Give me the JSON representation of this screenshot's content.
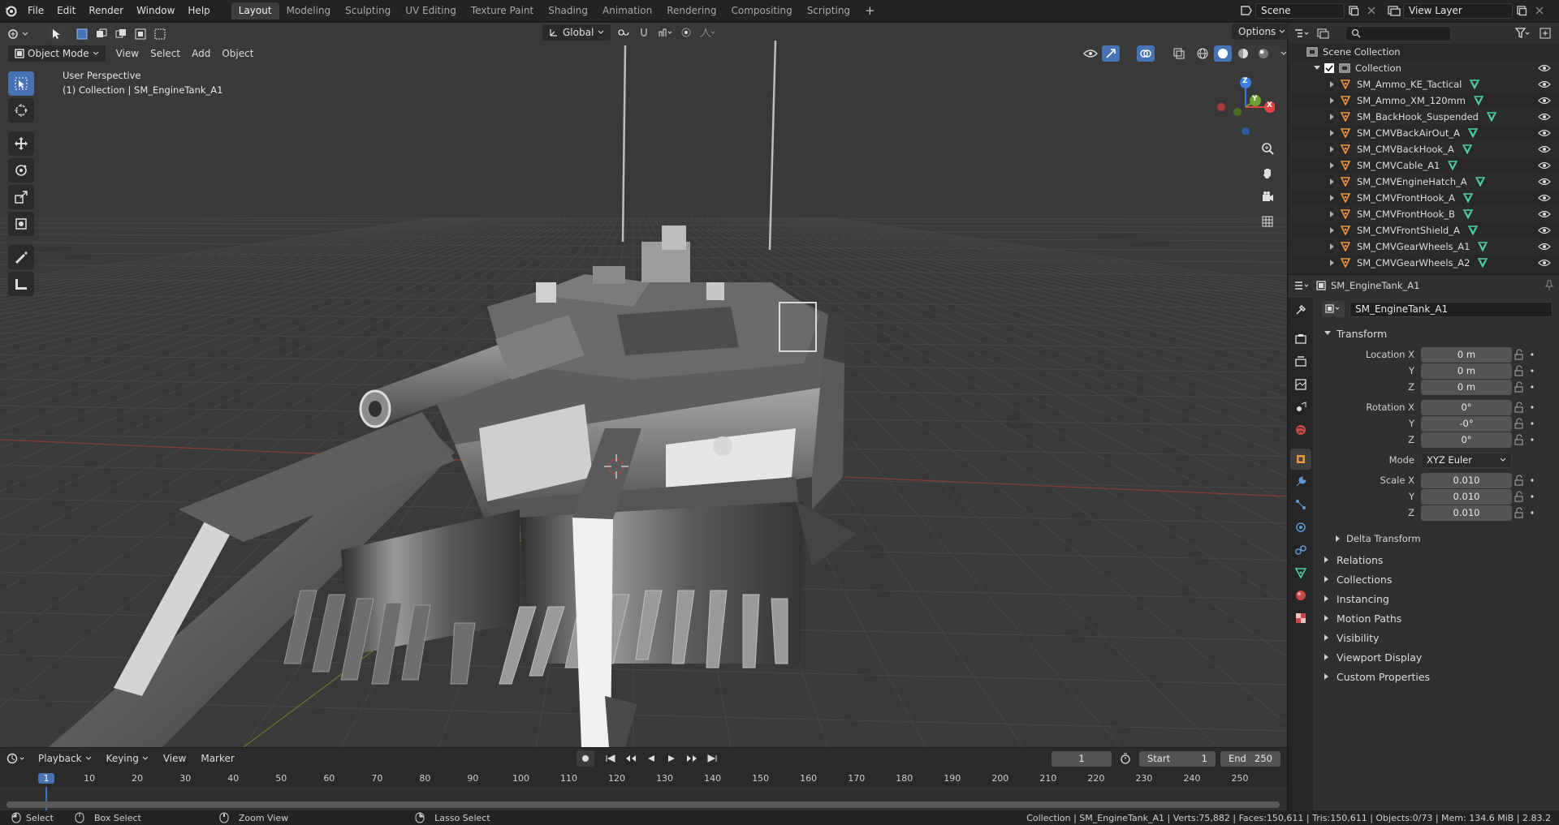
{
  "app": {
    "menu": [
      "File",
      "Edit",
      "Render",
      "Window",
      "Help"
    ]
  },
  "workspaces": {
    "tabs": [
      "Layout",
      "Modeling",
      "Sculpting",
      "UV Editing",
      "Texture Paint",
      "Shading",
      "Animation",
      "Rendering",
      "Compositing",
      "Scripting"
    ],
    "active": "Layout",
    "add": "+"
  },
  "scene": {
    "name": "Scene",
    "view_layer": "View Layer"
  },
  "viewport": {
    "mode": "Object Mode",
    "menus": [
      "View",
      "Select",
      "Add",
      "Object"
    ],
    "transform_orientation": "Global",
    "options_label": "Options",
    "overlay_line1": "User Perspective",
    "overlay_line2": "(1) Collection | SM_EngineTank_A1",
    "gizmo": {
      "z": "Z",
      "y": "Y",
      "x": "X"
    }
  },
  "outliner": {
    "root": "Scene Collection",
    "collection": "Collection",
    "items": [
      "SM_Ammo_KE_Tactical",
      "SM_Ammo_XM_120mm",
      "SM_BackHook_Suspended",
      "SM_CMVBackAirOut_A",
      "SM_CMVBackHook_A",
      "SM_CMVCable_A1",
      "SM_CMVEngineHatch_A",
      "SM_CMVFrontHook_A",
      "SM_CMVFrontHook_B",
      "SM_CMVFrontShield_A",
      "SM_CMVGearWheels_A1",
      "SM_CMVGearWheels_A2"
    ]
  },
  "properties": {
    "header_object": "SM_EngineTank_A1",
    "object_name": "SM_EngineTank_A1",
    "transform": {
      "title": "Transform",
      "location": {
        "label_x": "Location X",
        "x": "0 m",
        "y": "0 m",
        "z": "0 m"
      },
      "rotation": {
        "label_x": "Rotation X",
        "x": "0°",
        "y": "-0°",
        "z": "0°"
      },
      "mode_label": "Mode",
      "mode": "XYZ Euler",
      "scale": {
        "label_x": "Scale X",
        "x": "0.010",
        "y": "0.010",
        "z": "0.010"
      },
      "axis_y": "Y",
      "axis_z": "Z"
    },
    "delta_transform": "Delta Transform",
    "panels": [
      "Relations",
      "Collections",
      "Instancing",
      "Motion Paths",
      "Visibility",
      "Viewport Display",
      "Custom Properties"
    ]
  },
  "timeline": {
    "menus": [
      "Playback",
      "Keying",
      "View",
      "Marker"
    ],
    "current_frame": "1",
    "start_label": "Start",
    "start": "1",
    "end_label": "End",
    "end": "250",
    "ticks": [
      "1",
      "10",
      "20",
      "30",
      "40",
      "50",
      "60",
      "70",
      "80",
      "90",
      "100",
      "110",
      "120",
      "130",
      "140",
      "150",
      "160",
      "170",
      "180",
      "190",
      "200",
      "210",
      "220",
      "230",
      "240",
      "250"
    ]
  },
  "status": {
    "select": "Select",
    "box_select": "Box Select",
    "zoom_view": "Zoom View",
    "lasso_select": "Lasso Select",
    "info": "Collection | SM_EngineTank_A1 | Verts:75,882 | Faces:150,611 | Tris:150,611 | Objects:0/73 | Mem: 134.6 MiB | 2.83.2"
  },
  "colors": {
    "accent": "#4772b3",
    "object_orange": "#e8973c",
    "mesh_green": "#4fd1a3"
  }
}
